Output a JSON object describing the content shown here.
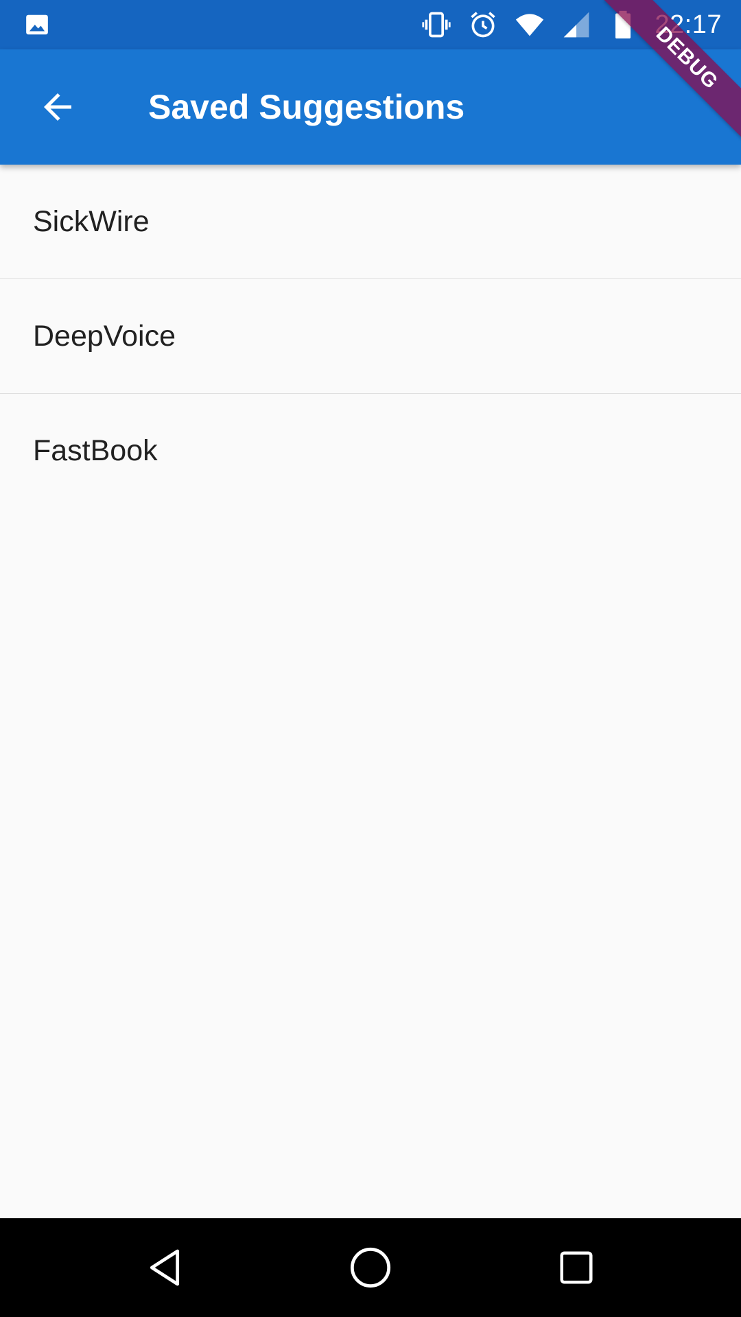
{
  "status_bar": {
    "time": "22:17",
    "icons": [
      "gallery-icon",
      "vibrate-icon",
      "alarm-icon",
      "wifi-icon",
      "signal-icon",
      "battery-icon"
    ]
  },
  "app_bar": {
    "title": "Saved Suggestions",
    "back_icon": "arrow-back-icon",
    "color": "#1976d2"
  },
  "debug_banner": {
    "label": "DEBUG"
  },
  "saved_list": {
    "items": [
      {
        "label": "SickWire"
      },
      {
        "label": "DeepVoice"
      },
      {
        "label": "FastBook"
      }
    ]
  },
  "nav_bar": {
    "buttons": [
      "back-triangle-icon",
      "home-circle-icon",
      "recents-square-icon"
    ]
  }
}
